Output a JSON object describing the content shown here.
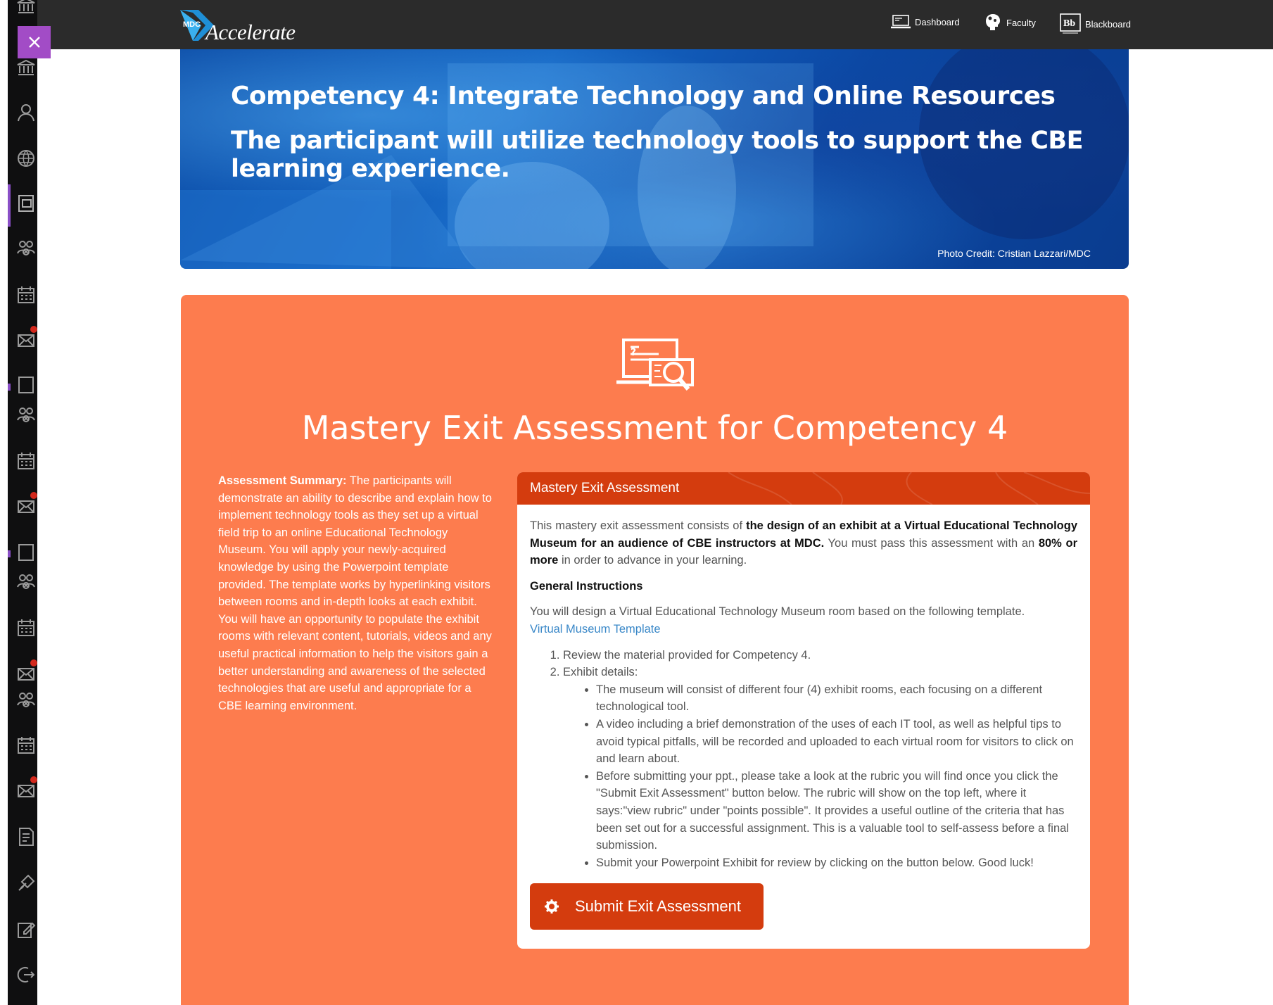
{
  "topnav": {
    "logo_badge": "MDC",
    "logo_text": "Accelerate",
    "items": [
      {
        "label": "Dashboard",
        "icon": "laptop-icon"
      },
      {
        "label": "Faculty",
        "icon": "faculty-head-icon"
      },
      {
        "label": "Blackboard",
        "icon": "blackboard-logo-icon"
      }
    ]
  },
  "close_button": {
    "icon": "close-icon",
    "color": "#a24cc6"
  },
  "left_toolbar": {
    "icons": [
      "institution-icon",
      "user-icon",
      "globe-icon",
      "courses-icon",
      "groups-icon",
      "calendar-icon",
      "messages-icon",
      "courses-icon",
      "groups-icon",
      "calendar-icon",
      "messages-icon",
      "courses-icon",
      "groups-icon",
      "calendar-icon",
      "messages-icon",
      "groups-icon",
      "calendar-icon",
      "messages-icon",
      "grades-icon",
      "tools-icon",
      "edit-icon",
      "sign-out-icon"
    ]
  },
  "hero": {
    "title": "Competency 4: Integrate Technology and Online Resources",
    "subtitle": "The participant will utilize technology tools to support the CBE learning experience.",
    "credit": "Photo Credit: Cristian Lazzari/MDC"
  },
  "assessment": {
    "icon": "assessment-laptop-icon",
    "title": "Mastery Exit Assessment for Competency 4",
    "summary_label": "Assessment Summary:",
    "summary_text": " The participants will demonstrate an ability to describe and explain how to implement technology tools as they set up a virtual field trip to an online Educational Technology Museum. You will apply your newly-acquired knowledge by using the Powerpoint template provided. The template works by hyperlinking visitors between rooms and in-depth looks at each exhibit. You will have an opportunity to populate the exhibit rooms with relevant content, tutorials, videos and any useful practical information to help the visitors gain a better understanding and awareness of the selected technologies that are useful and appropriate for a CBE learning environment.",
    "card_title": "Mastery Exit Assessment",
    "intro_1": "This mastery exit assessment consists of ",
    "intro_bold_1": "the design of an exhibit at a Virtual Educational Technology Museum for an audience of CBE instructors at MDC.",
    "intro_2": " You must pass this assessment with an ",
    "intro_bold_2": "80% or more",
    "intro_3": " in order to advance in your learning.",
    "general_heading": "General Instructions",
    "general_text": "You will design a Virtual Educational Technology Museum room based on the following template.",
    "template_link": "Virtual Museum Template",
    "steps": [
      "Review the material provided for Competency 4.",
      "Exhibit details:"
    ],
    "details": [
      "The museum will consist of different four (4) exhibit rooms, each focusing on a different technological tool.",
      "A video including a brief demonstration of the uses of each IT tool, as well as helpful tips to avoid typical pitfalls, will be recorded and uploaded to each virtual room for visitors to click on and learn about.",
      "Before submitting your ppt., please take a look at the rubric you will find once you click the \"Submit Exit Assessment\" button below. The rubric will show on the top left, where it says:\"view rubric\" under \"points possible\". It provides a useful outline of the criteria that has been set out for a successful assignment. This is a valuable tool to self-assess before a final submission.",
      "Submit your Powerpoint Exhibit for review by clicking on the button below. Good luck!"
    ],
    "submit_label": "Submit Exit Assessment",
    "submit_icon": "gear-icon"
  },
  "colors": {
    "panel": "#fd7c4e",
    "card_header": "#d43c0e",
    "link": "#3a88c8",
    "topbar": "#2b2b2b"
  }
}
